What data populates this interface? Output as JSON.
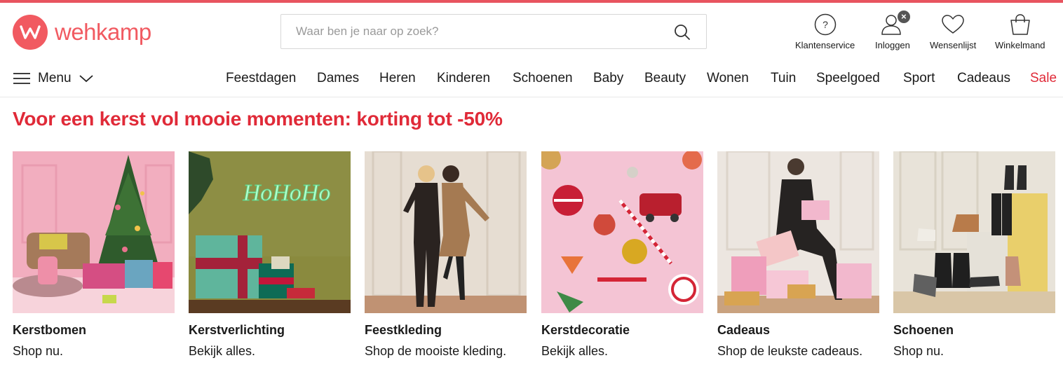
{
  "brand": {
    "name": "wehkamp",
    "color": "#f15a61"
  },
  "search": {
    "placeholder": "Waar ben je naar op zoek?"
  },
  "header_tools": [
    {
      "label": "Klantenservice",
      "icon": "help-icon"
    },
    {
      "label": "Inloggen",
      "icon": "user-icon",
      "badge": "×"
    },
    {
      "label": "Wensenlijst",
      "icon": "heart-icon"
    },
    {
      "label": "Winkelmand",
      "icon": "bag-icon"
    }
  ],
  "menu": {
    "label": "Menu"
  },
  "nav": [
    "Feestdagen",
    "Dames",
    "Heren",
    "Kinderen",
    "Schoenen",
    "Baby",
    "Beauty",
    "Wonen",
    "Tuin",
    "Speelgoed",
    "Sport",
    "Cadeaus",
    "Sale"
  ],
  "headline": "Voor een kerst vol mooie momenten: korting tot -50%",
  "accent_color": "#e02a38",
  "tiles": [
    {
      "title": "Kerstbomen",
      "subtitle": "Shop nu."
    },
    {
      "title": "Kerstverlichting",
      "subtitle": "Bekijk alles.",
      "image_text": "HoHoHo"
    },
    {
      "title": "Feestkleding",
      "subtitle": "Shop de mooiste kleding."
    },
    {
      "title": "Kerstdecoratie",
      "subtitle": "Bekijk alles."
    },
    {
      "title": "Cadeaus",
      "subtitle": "Shop de leukste cadeaus."
    },
    {
      "title": "Schoenen",
      "subtitle": "Shop nu."
    }
  ]
}
